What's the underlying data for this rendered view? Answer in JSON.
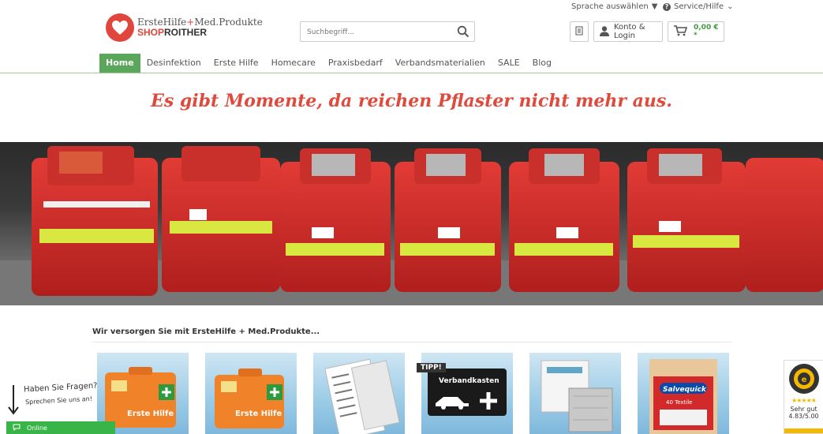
{
  "topbar": {
    "language_label": "Sprache auswählen",
    "service_label": "Service/Hilfe"
  },
  "logo": {
    "line1_a": "ErsteHilfe",
    "line1_plus": "+",
    "line1_b": "Med.Produkte",
    "line2_a": "SHOP",
    "line2_b": "ROITHER"
  },
  "search": {
    "placeholder": "Suchbegriff..."
  },
  "header": {
    "account_label": "Konto & Login",
    "cart_amount": "0,00 € *"
  },
  "nav": {
    "items": [
      "Home",
      "Desinfektion",
      "Erste Hilfe",
      "Homecare",
      "Praxisbedarf",
      "Verbandsmaterialien",
      "SALE",
      "Blog"
    ]
  },
  "headline": "Es gibt Momente, da reichen Pflaster nicht mehr aus.",
  "section": {
    "title": "Wir versorgen Sie mit ErsteHilfe + Med.Produkte..."
  },
  "products": {
    "p1_label": "Erste Hilfe",
    "p2_label": "Erste Hilfe",
    "p4_label": "Verbandkasten",
    "p4_tip": "TIPP!",
    "p6_brand": "Salvequick",
    "p6_sub": "40 Textile"
  },
  "chat": {
    "question": "Haben Sie Fragen?",
    "subtext": "Sprechen Sie uns an!",
    "status": "Online"
  },
  "trust": {
    "stars": "★★★★★",
    "rating_text": "Sehr gut",
    "rating_score": "4.83/5.00"
  },
  "colors": {
    "accent_red": "#e0463b",
    "nav_active_green": "#5aa65a",
    "cart_green": "#3f9b3f",
    "chat_green": "#38b449"
  }
}
